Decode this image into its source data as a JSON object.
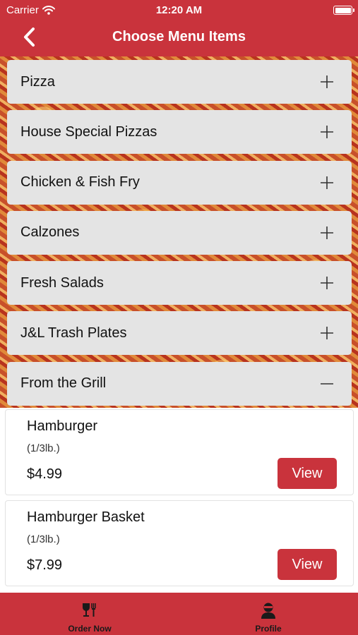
{
  "status_bar": {
    "carrier": "Carrier",
    "time": "12:20 AM"
  },
  "nav": {
    "title": "Choose Menu Items"
  },
  "categories": [
    {
      "label": "Pizza",
      "expanded": false
    },
    {
      "label": "House Special Pizzas",
      "expanded": false
    },
    {
      "label": "Chicken & Fish Fry",
      "expanded": false
    },
    {
      "label": "Calzones",
      "expanded": false
    },
    {
      "label": "Fresh Salads",
      "expanded": false
    },
    {
      "label": "J&L Trash Plates",
      "expanded": false
    },
    {
      "label": "From the Grill",
      "expanded": true
    }
  ],
  "items": [
    {
      "name": "Hamburger",
      "description": "(1/3lb.)",
      "price": "$4.99",
      "button": "View"
    },
    {
      "name": "Hamburger Basket",
      "description": "(1/3lb.)",
      "price": "$7.99",
      "button": "View"
    }
  ],
  "tabs": [
    {
      "label": "Order Now",
      "icon": "dining-icon"
    },
    {
      "label": "Profile",
      "icon": "profile-icon"
    }
  ],
  "colors": {
    "brand": "#c9333c",
    "accordion_bg": "#e4e4e4"
  }
}
